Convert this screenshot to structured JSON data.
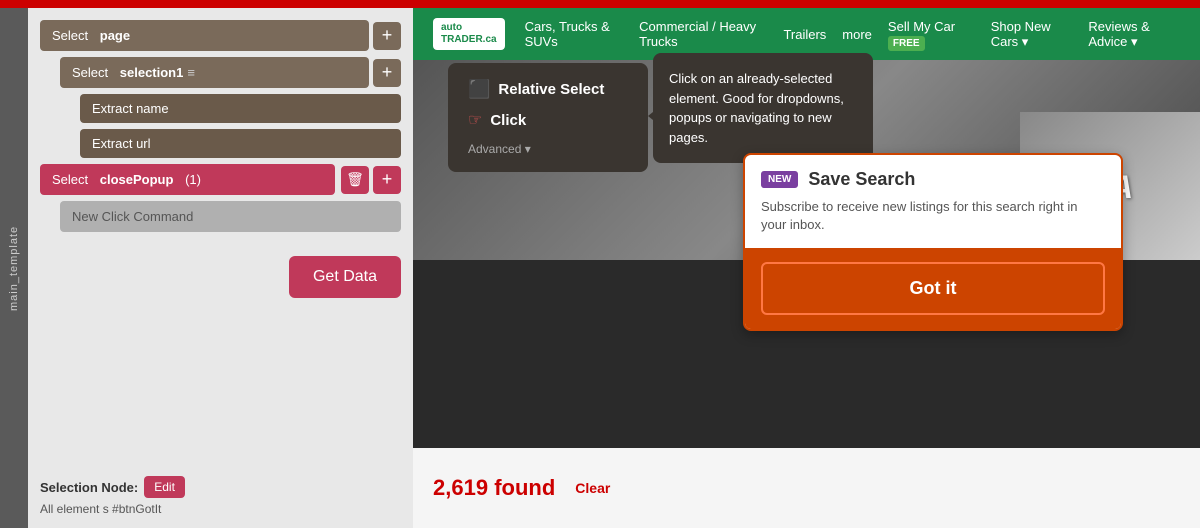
{
  "topBar": {},
  "sidebar": {
    "label": "main_template"
  },
  "leftPanel": {
    "selectPage": {
      "prefix": "Select",
      "value": "page"
    },
    "selectSelection1": {
      "prefix": "Select",
      "value": "selection1"
    },
    "extractName": {
      "prefix": "Extract",
      "value": "name"
    },
    "extractUrl": {
      "prefix": "Extract",
      "value": "url"
    },
    "selectClosePopup": {
      "prefix": "Select",
      "value": "closePopup",
      "badge": "(1)"
    },
    "newClickCommand": "New Click Command",
    "getDataBtn": "Get Data",
    "selectionNode": {
      "label": "Selection Node:",
      "editBtn": "Edit",
      "info": "All element s #btnGotIt"
    }
  },
  "relativeSelectPopup": {
    "title": "Relative Select",
    "clickLabel": "Click",
    "advancedLabel": "Advanced ▾",
    "description": "Click on an already-selected element. Good for dropdowns, popups or navigating to new pages."
  },
  "saveSearchDialog": {
    "newBadge": "NEW",
    "title": "Save Search",
    "description": "Subscribe to receive new listings for this search right in your inbox.",
    "gotItBtn": "Got it"
  },
  "autotrader": {
    "logo": {
      "line1": "auto",
      "line2": "TRADER.ca"
    },
    "navLinks": [
      "Cars, Trucks & SUVs",
      "Commercial / Heavy Trucks",
      "Trailers",
      "more"
    ],
    "sellMyCar": "Sell My Car",
    "freeBadge": "FREE",
    "shopNewCars": "Shop New Cars",
    "reviewsAdvice": "Reviews & Advice",
    "foundCount": "2,619",
    "foundLabel": "found",
    "clearBtn": "Clear",
    "hondaText": "CA"
  }
}
